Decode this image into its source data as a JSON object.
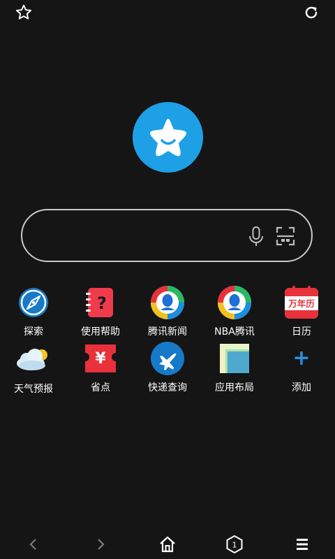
{
  "top_bar": {
    "left_icon": "star-outline-icon",
    "right_icon": "refresh-icon"
  },
  "logo": {
    "icon": "smiling-star-logo"
  },
  "search": {
    "value": "",
    "placeholder": "",
    "mic_icon": "microphone-icon",
    "scan_icon": "scan-icon"
  },
  "shortcuts": [
    {
      "label": "探索",
      "icon": "compass-icon"
    },
    {
      "label": "使用帮助",
      "icon": "help-notebook-icon"
    },
    {
      "label": "腾讯新闻",
      "icon": "tencent-news-icon"
    },
    {
      "label": "NBA腾讯",
      "icon": "nba-tencent-icon"
    },
    {
      "label": "日历",
      "icon": "calendar-icon",
      "badge_text": "万年历"
    },
    {
      "label": "天气预报",
      "icon": "weather-icon"
    },
    {
      "label": "省点",
      "icon": "yen-coupon-icon",
      "badge_text": "¥"
    },
    {
      "label": "快递查询",
      "icon": "airplane-icon"
    },
    {
      "label": "应用布局",
      "icon": "layout-icon"
    },
    {
      "label": "添加",
      "icon": "plus-icon",
      "badge_text": "+"
    }
  ],
  "bottom_bar": {
    "back_icon": "chevron-left-icon",
    "forward_icon": "chevron-right-icon",
    "home_icon": "home-icon",
    "tabs_count": "1",
    "menu_icon": "menu-icon"
  },
  "colors": {
    "background": "#151515",
    "accent_blue": "#1ea0e6",
    "red": "#e8313a",
    "white": "#ffffff"
  }
}
